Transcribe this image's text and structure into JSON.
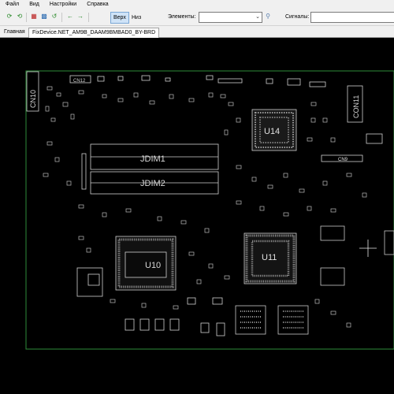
{
  "menu": {
    "file": "Файл",
    "view": "Вид",
    "settings": "Настройки",
    "help": "Справка"
  },
  "toolbar": {
    "top_label": "Верх",
    "bottom_label": "Низ",
    "elements_label": "Элементы:",
    "elements_value": "",
    "signals_label": "Сигналы:",
    "signals_value": ""
  },
  "tabs": {
    "home": "Главная",
    "document": "FixDevice.NET_AM9B_DAAM9BMBAD0_BY-BRD"
  },
  "board": {
    "labels": {
      "cn10": "CN10",
      "cn12": "CN12",
      "cn11": "CON11",
      "cn9": "CN9",
      "jdim1": "JDIM1",
      "jdim2": "JDIM2",
      "u14": "U14",
      "u10": "U10",
      "u11": "U11"
    },
    "colors": {
      "background": "#000000",
      "outline": "#2e8b3a",
      "silkscreen": "#d0d0d0"
    }
  }
}
